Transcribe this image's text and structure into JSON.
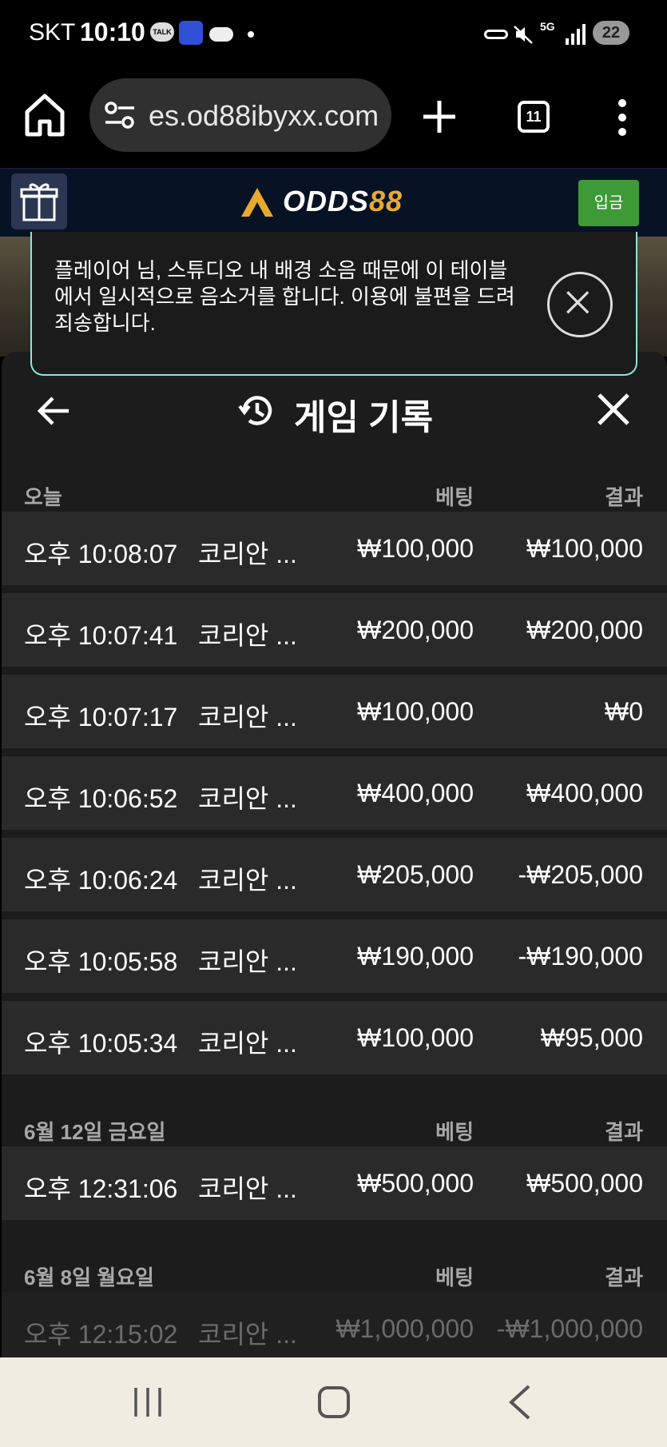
{
  "status_bar": {
    "carrier": "SKT",
    "time": "10:10",
    "talk_badge": "TALK",
    "network": "5G",
    "battery": "22"
  },
  "browser": {
    "url": "es.od88ibyxx.com",
    "tab_count": "11"
  },
  "site_header": {
    "logo_white": "ODDS",
    "logo_gold": "88",
    "deposit_label": "입금",
    "accent_color": "#e8a930",
    "deposit_color": "#3d9a37"
  },
  "notice": {
    "message": "플레이어 님, 스튜디오 내 배경 소음 때문에 이 테이블에서 일시적으로 음소거를 합니다. 이용에 불편을 드려 죄송합니다."
  },
  "panel": {
    "title": "게임 기록"
  },
  "sections": [
    {
      "date": "오늘",
      "bet_header": "베팅",
      "result_header": "결과",
      "rows": [
        {
          "time": "오후 10:08:07",
          "game": "코리안 ...",
          "bet": "₩100,000",
          "result": "₩100,000"
        },
        {
          "time": "오후 10:07:41",
          "game": "코리안 ...",
          "bet": "₩200,000",
          "result": "₩200,000"
        },
        {
          "time": "오후 10:07:17",
          "game": "코리안 ...",
          "bet": "₩100,000",
          "result": "₩0"
        },
        {
          "time": "오후 10:06:52",
          "game": "코리안 ...",
          "bet": "₩400,000",
          "result": "₩400,000"
        },
        {
          "time": "오후 10:06:24",
          "game": "코리안 ...",
          "bet": "₩205,000",
          "result": "-₩205,000"
        },
        {
          "time": "오후 10:05:58",
          "game": "코리안 ...",
          "bet": "₩190,000",
          "result": "-₩190,000"
        },
        {
          "time": "오후 10:05:34",
          "game": "코리안 ...",
          "bet": "₩100,000",
          "result": "₩95,000"
        }
      ]
    },
    {
      "date": "6월 12일 금요일",
      "bet_header": "베팅",
      "result_header": "결과",
      "rows": [
        {
          "time": "오후 12:31:06",
          "game": "코리안 ...",
          "bet": "₩500,000",
          "result": "₩500,000"
        }
      ]
    },
    {
      "date": "6월 8일 월요일",
      "bet_header": "베팅",
      "result_header": "결과",
      "rows": [
        {
          "time": "오후 12:15:02",
          "game": "코리안 ...",
          "bet": "₩1,000,000",
          "result": "-₩1,000,000"
        }
      ]
    }
  ]
}
